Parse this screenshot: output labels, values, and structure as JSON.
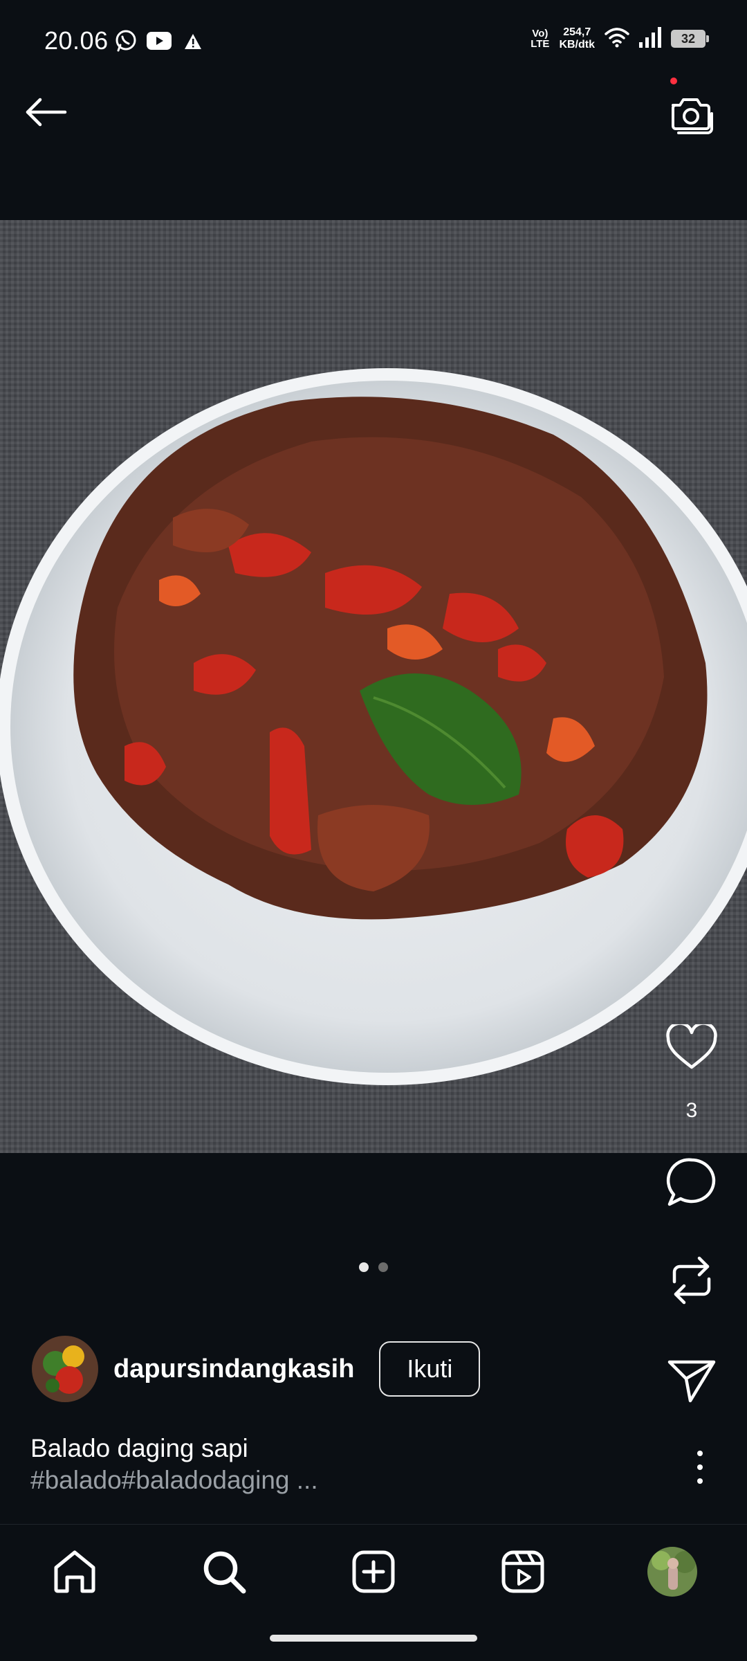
{
  "status_bar": {
    "time": "20.06",
    "network_label_top": "Vo)",
    "network_label_bottom": "LTE",
    "speed_value": "254,7",
    "speed_unit": "KB/dtk",
    "battery": "32",
    "icons": [
      "whatsapp-icon",
      "youtube-icon",
      "warning-icon",
      "wifi-icon",
      "signal-icon",
      "battery-icon"
    ]
  },
  "top_bar": {
    "icons": [
      "back-arrow-icon",
      "camera-icon"
    ]
  },
  "post": {
    "like_count": "3",
    "carousel": {
      "count": 2,
      "active": 1
    },
    "author": {
      "username": "dapursindangkasih",
      "follow_label": "Ikuti"
    },
    "caption": {
      "title": "Balado daging sapi",
      "tags": "#balado#baladodaging ..."
    }
  },
  "actions": [
    "heart-icon",
    "comment-icon",
    "repost-icon",
    "share-icon",
    "more-icon"
  ],
  "bottom_nav": [
    "home-icon",
    "search-icon",
    "create-icon",
    "reels-icon",
    "profile-avatar"
  ],
  "colors": {
    "background": "#0b0f14",
    "notification_dot": "#ff3040",
    "tag_text": "#9aa0a6"
  }
}
